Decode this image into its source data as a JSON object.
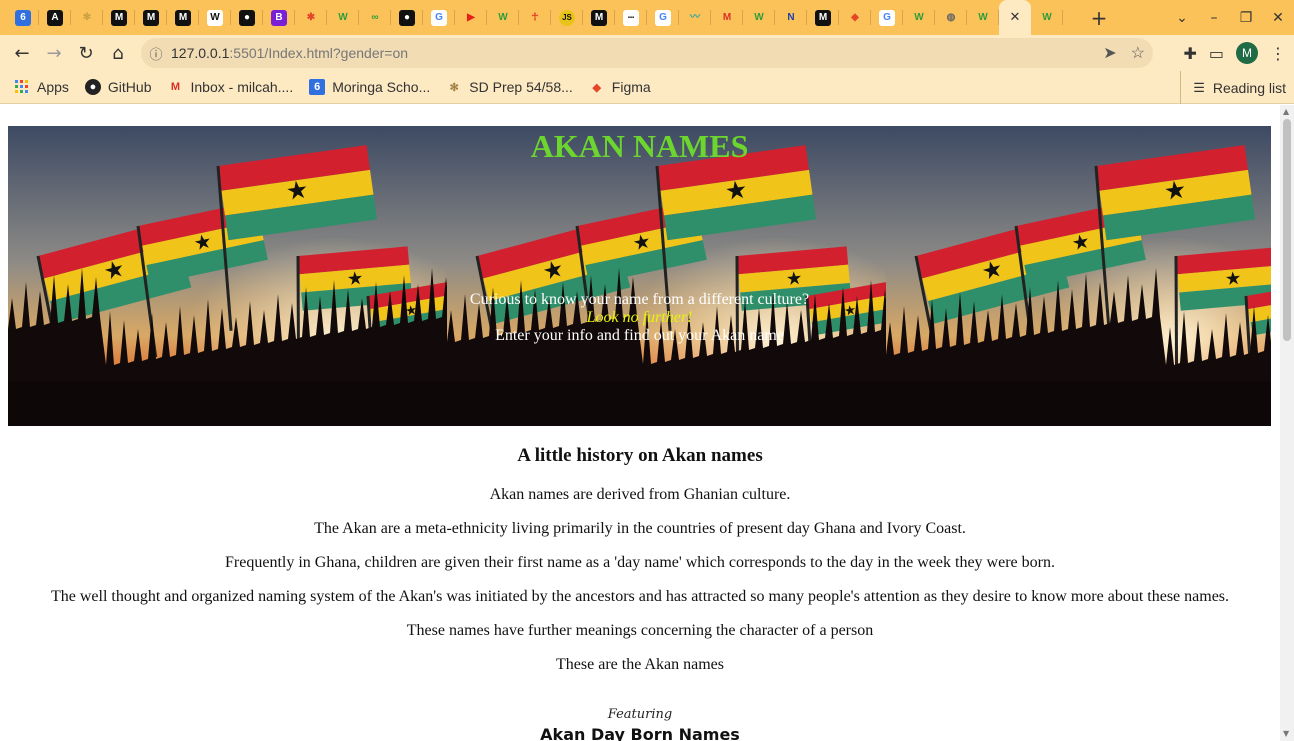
{
  "browser": {
    "tabs": [
      {
        "icon": "num6-icon",
        "glyph": "6",
        "color": "#2f6fe0"
      },
      {
        "icon": "angular-icon",
        "glyph": "A",
        "color": "#111"
      },
      {
        "icon": "palm-icon",
        "glyph": "✻",
        "color": "#c8a040"
      },
      {
        "icon": "medium-icon",
        "glyph": "M",
        "color": "#111"
      },
      {
        "icon": "medium-icon",
        "glyph": "M",
        "color": "#111"
      },
      {
        "icon": "medium-icon",
        "glyph": "M",
        "color": "#111"
      },
      {
        "icon": "wikipedia-icon",
        "glyph": "W",
        "color": "#fff"
      },
      {
        "icon": "github-icon",
        "glyph": "●",
        "color": "#111"
      },
      {
        "icon": "bootstrap-icon",
        "glyph": "B",
        "color": "#7b1fd6"
      },
      {
        "icon": "asterisk-icon",
        "glyph": "✱",
        "color": "#e5462a"
      },
      {
        "icon": "w3-icon",
        "glyph": "W",
        "color": "#2e9e3a"
      },
      {
        "icon": "geeks-icon",
        "glyph": "∞",
        "color": "#2e9e3a"
      },
      {
        "icon": "github-icon",
        "glyph": "●",
        "color": "#111"
      },
      {
        "icon": "google-icon",
        "glyph": "G",
        "color": "#fff"
      },
      {
        "icon": "youtube-icon",
        "glyph": "▶",
        "color": "#e62117"
      },
      {
        "icon": "w3-icon",
        "glyph": "W",
        "color": "#2e9e3a"
      },
      {
        "icon": "figure-icon",
        "glyph": "☥",
        "color": "#e5462a"
      },
      {
        "icon": "js-icon",
        "glyph": "JS",
        "color": "#e8c41a"
      },
      {
        "icon": "medium-icon",
        "glyph": "M",
        "color": "#111"
      },
      {
        "icon": "dots-icon",
        "glyph": "▪▪▪",
        "color": "#111"
      },
      {
        "icon": "google-icon",
        "glyph": "G",
        "color": "#fff"
      },
      {
        "icon": "wave-icon",
        "glyph": "〰",
        "color": "#2aa7a0"
      },
      {
        "icon": "gmail-icon",
        "glyph": "M",
        "color": "#d93025"
      },
      {
        "icon": "w3-icon",
        "glyph": "W",
        "color": "#2e9e3a"
      },
      {
        "icon": "notion-icon",
        "glyph": "N",
        "color": "#1f3fa8"
      },
      {
        "icon": "medium-icon",
        "glyph": "M",
        "color": "#111"
      },
      {
        "icon": "figma-icon",
        "glyph": "◆",
        "color": "#e5462a"
      },
      {
        "icon": "google-icon",
        "glyph": "G",
        "color": "#fff"
      },
      {
        "icon": "w3-icon",
        "glyph": "W",
        "color": "#2e9e3a"
      },
      {
        "icon": "globe-icon",
        "glyph": "◍",
        "color": "#666"
      },
      {
        "icon": "w3-icon",
        "glyph": "W",
        "color": "#2e9e3a"
      }
    ],
    "url_host": "127.0.0.1",
    "url_rest": ":5501/Index.html?gender=on",
    "avatar_letter": "M",
    "bookmarks": [
      {
        "label": "Apps",
        "icon": "apps-grid-icon"
      },
      {
        "label": "GitHub",
        "icon": "github-icon"
      },
      {
        "label": "Inbox - milcah....",
        "icon": "gmail-icon"
      },
      {
        "label": "Moringa Scho...",
        "icon": "num6-icon"
      },
      {
        "label": "SD Prep 54/58...",
        "icon": "palm-icon"
      },
      {
        "label": "Figma",
        "icon": "figma-icon"
      }
    ],
    "reading_list": "Reading list"
  },
  "page": {
    "title": "AKAN NAMES",
    "hero_line1": "Curious to know your name from a different culture?",
    "hero_line2": "Look no further!",
    "hero_line3": "Enter your info and find out your Akan name",
    "history_heading": "A little history on Akan names",
    "paragraphs": [
      "Akan names are derived from Ghanian culture.",
      "The Akan are a meta-ethnicity living primarily in the countries of present day Ghana and Ivory Coast.",
      "Frequently in Ghana, children are given their first name as a 'day name' which corresponds to the day in the week they were born.",
      "The well thought and organized naming system of the Akan's was initiated by the ancestors and has attracted so many people's attention as they desire to know more about these names.",
      "These names have further meanings concerning the character of a person",
      "These are the Akan names"
    ],
    "featuring": "Featuring",
    "featuring_title": "Akan Day Born Names"
  },
  "colors": {
    "tabstrip": "#fcc25a",
    "toolbar": "#fde9c2",
    "title_green": "#6cd62e",
    "highlight_yellow": "#e8f50a"
  }
}
